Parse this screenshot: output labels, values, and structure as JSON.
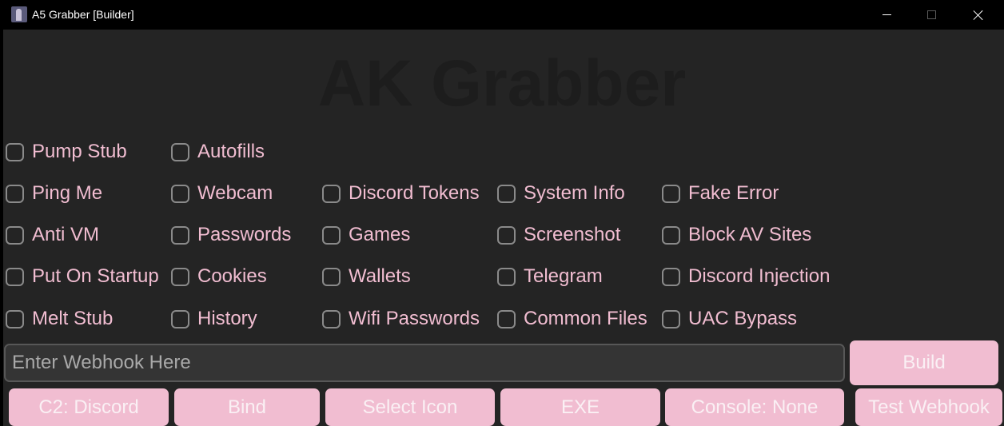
{
  "window": {
    "title": "A5 Grabber [Builder]"
  },
  "heading": "AK Grabber",
  "options": {
    "pump_stub": "Pump Stub",
    "autofills": "Autofills",
    "ping_me": "Ping Me",
    "webcam": "Webcam",
    "discord_tokens": "Discord Tokens",
    "system_info": "System Info",
    "fake_error": "Fake Error",
    "anti_vm": "Anti VM",
    "passwords": "Passwords",
    "games": "Games",
    "screenshot": "Screenshot",
    "block_av_sites": "Block AV Sites",
    "put_on_startup": "Put On Startup",
    "cookies": "Cookies",
    "wallets": "Wallets",
    "telegram": "Telegram",
    "discord_injection": "Discord Injection",
    "melt_stub": "Melt Stub",
    "history": "History",
    "wifi_passwords": "Wifi Passwords",
    "common_files": "Common Files",
    "uac_bypass": "UAC Bypass"
  },
  "webhook": {
    "placeholder": "Enter Webhook Here",
    "value": ""
  },
  "buttons": {
    "build": "Build",
    "c2": "C2: Discord",
    "bind": "Bind",
    "select_icon": "Select Icon",
    "exe": "EXE",
    "console": "Console: None",
    "test_webhook": "Test Webhook"
  },
  "colors": {
    "background": "#242424",
    "titlebar": "#000000",
    "accent_pink": "#f1bdd1",
    "heading": "#1d1d1d",
    "checkbox_border": "#8a8a8a"
  }
}
